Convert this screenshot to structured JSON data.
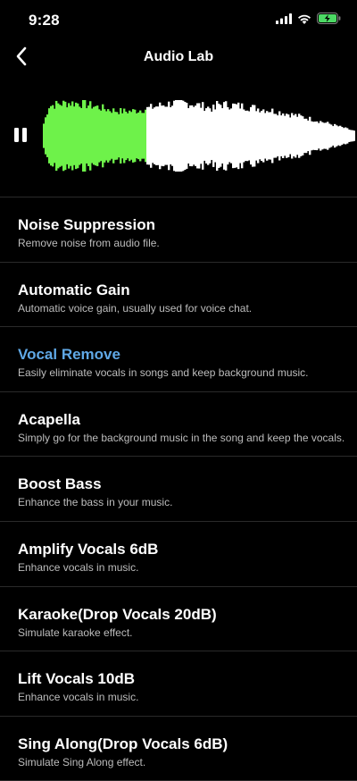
{
  "status": {
    "time": "9:28",
    "icons": [
      "cellular-icon",
      "wifi-icon",
      "battery-charging-icon"
    ]
  },
  "header": {
    "title": "Audio Lab",
    "back_icon": "chevron-left-icon"
  },
  "player": {
    "state_icon": "pause-icon",
    "progress": 0.33,
    "progress_color": "#6ef24a",
    "wave_color": "#ffffff"
  },
  "colors": {
    "accent": "#5fa8e6",
    "background": "#000000"
  },
  "effects": [
    {
      "title": "Noise Suppression",
      "desc": "Remove noise from audio file.",
      "active": false
    },
    {
      "title": "Automatic Gain",
      "desc": "Automatic voice gain, usually used for voice chat.",
      "active": false
    },
    {
      "title": "Vocal Remove",
      "desc": "Easily eliminate vocals in songs and keep background music.",
      "active": true
    },
    {
      "title": "Acapella",
      "desc": "Simply go for the background music in the song and keep the vocals.",
      "active": false
    },
    {
      "title": "Boost Bass",
      "desc": "Enhance the bass in your music.",
      "active": false
    },
    {
      "title": "Amplify Vocals 6dB",
      "desc": "Enhance vocals in music.",
      "active": false
    },
    {
      "title": "Karaoke(Drop Vocals 20dB)",
      "desc": "Simulate karaoke effect.",
      "active": false
    },
    {
      "title": "Lift Vocals 10dB",
      "desc": "Enhance vocals in music.",
      "active": false
    },
    {
      "title": "Sing Along(Drop Vocals 6dB)",
      "desc": "Simulate Sing Along effect.",
      "active": false
    }
  ]
}
